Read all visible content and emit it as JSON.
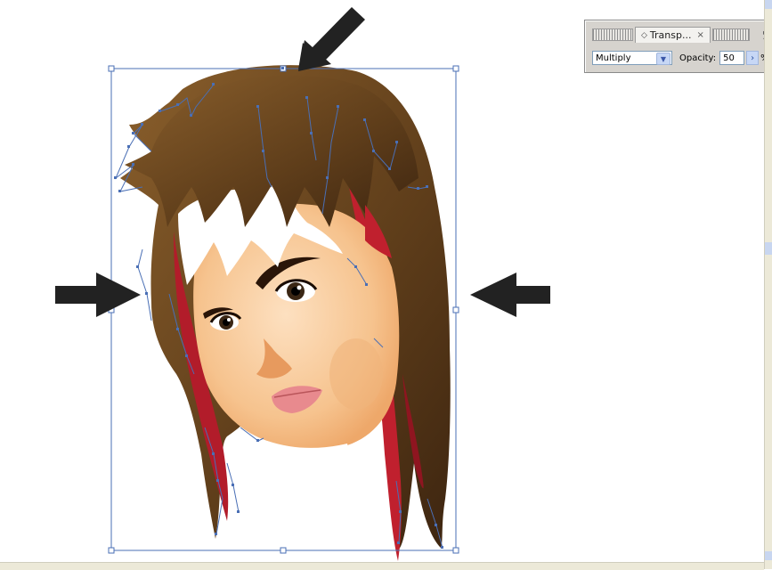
{
  "transparency_panel": {
    "tab_label": "Transp...",
    "tab_close": "×",
    "blend_mode": "Multiply",
    "opacity_label": "Opacity:",
    "opacity_value": "50",
    "opacity_unit": "%",
    "stepper_glyph": "›"
  },
  "colors": {
    "selection": "#4a6fb5",
    "arrow": "#222222",
    "hair_brown": "#6b4a22",
    "hair_red": "#c0202e",
    "skin": "#f7c99a"
  },
  "icons": {
    "pointer_arrows": [
      "arrow-down-left-icon",
      "arrow-right-icon",
      "arrow-left-icon"
    ]
  }
}
